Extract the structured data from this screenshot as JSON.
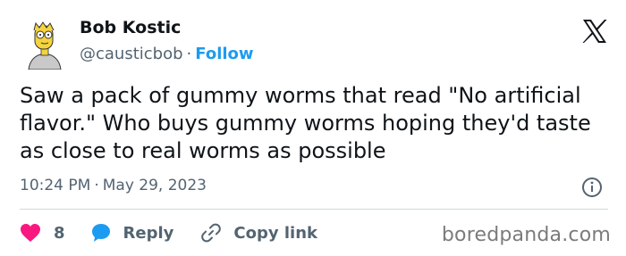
{
  "author": {
    "name": "Bob Kostic",
    "handle": "@causticbob",
    "separator": "·",
    "follow_label": "Follow"
  },
  "tweet": {
    "text": "Saw a pack of gummy worms that read \"No artificial flavor.\" Who buys gummy worms hoping they'd taste as close to real worms as possible",
    "time": "10:24 PM",
    "separator": "·",
    "date": "May 29, 2023"
  },
  "actions": {
    "like_count": "8",
    "reply_label": "Reply",
    "copy_label": "Copy link"
  },
  "watermark": "boredpanda.com",
  "icons": {
    "avatar": "simpsons-avatar",
    "logo": "x-logo-icon",
    "info": "info-icon",
    "like": "heart-icon",
    "reply": "speech-bubble-icon",
    "copy": "link-icon"
  },
  "colors": {
    "accent": "#1d9bf0",
    "like": "#f91880",
    "text": "#0f1419",
    "muted": "#536471"
  }
}
